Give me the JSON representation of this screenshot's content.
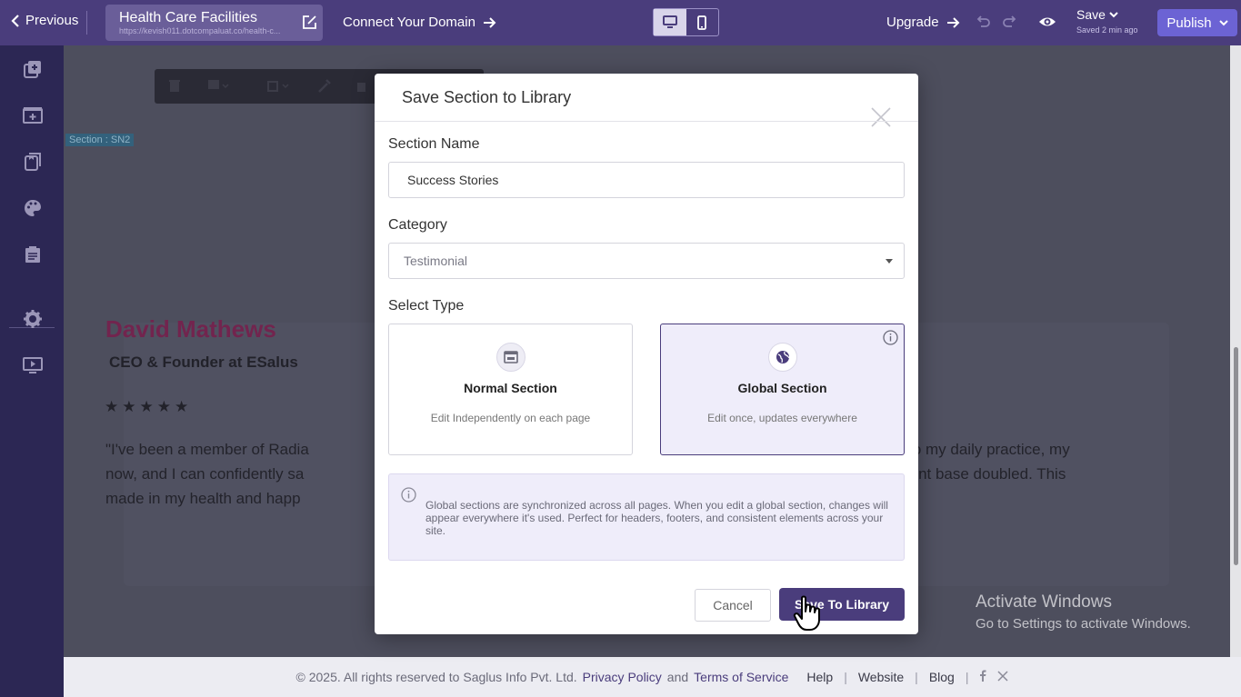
{
  "topbar": {
    "previous_label": "Previous",
    "site_title": "Health Care Facilities",
    "site_url": "https://kevish011.dotcompaluat.co/health-c...",
    "connect_domain_label": "Connect Your Domain",
    "upgrade_label": "Upgrade",
    "save_label": "Save",
    "saved_status": "Saved 2 min ago",
    "publish_label": "Publish"
  },
  "canvas": {
    "section_tag": "Section : SN2",
    "testimonial": {
      "name": "David Mathews",
      "title": "CEO & Founder at ESalus",
      "stars": "★★★★★",
      "quote_left_1": "\"I've been a member of Radia",
      "quote_left_2": "now, and I can confidently sa",
      "quote_left_3": "made in my health and happ",
      "quote_right_1": "Yoga into my daily practice, my",
      "quote_right_2": "d my client base doubled. This"
    }
  },
  "modal": {
    "title": "Save Section to Library",
    "section_name_label": "Section Name",
    "section_name_value": "Success Stories",
    "category_label": "Category",
    "category_value": "Testimonial",
    "select_type_label": "Select Type",
    "types": [
      {
        "name": "Normal Section",
        "desc": "Edit Independently on each page",
        "selected": false
      },
      {
        "name": "Global Section",
        "desc": "Edit once, updates everywhere",
        "selected": true
      }
    ],
    "note": "Global sections are synchronized across all pages. When you edit a global section, changes will appear everywhere it's used. Perfect for headers, footers, and consistent elements across your site.",
    "cancel_label": "Cancel",
    "save_label": "Save To Library"
  },
  "footer": {
    "copyright": "© 2025. All rights reserved to Saglus Info Pvt. Ltd.",
    "privacy": "Privacy Policy",
    "and": "and",
    "terms": "Terms of Service",
    "help": "Help",
    "website": "Website",
    "blog": "Blog",
    "sep": "|"
  },
  "watermark": {
    "line1": "Activate Windows",
    "line2": "Go to Settings to activate Windows."
  },
  "colors": {
    "brand": "#4a3d7c",
    "publish": "#6c63d4",
    "accent_name": "#72244e"
  }
}
